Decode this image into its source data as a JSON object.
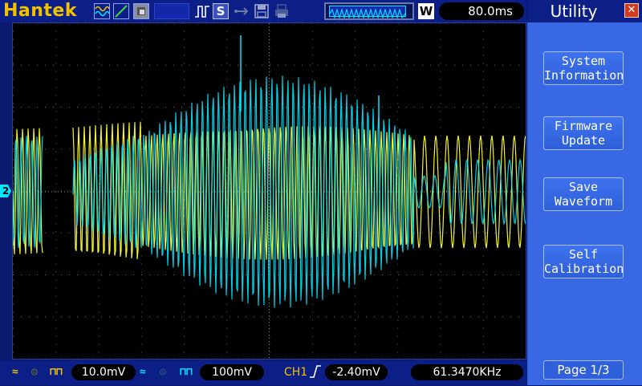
{
  "header": {
    "brand": "Hantek",
    "s_badge": "S",
    "w_badge": "W",
    "timebase": "80.0ms"
  },
  "footer": {
    "ch1_scale": "10.0mV",
    "ch2_scale": "100mV",
    "trigger_source": "CH1",
    "trigger_level": "-2.40mV",
    "frequency": "61.3470KHz"
  },
  "channel_marker": "2",
  "menu": {
    "title": "Utility",
    "close_glyph": "✕",
    "items": [
      {
        "line1": "System",
        "line2": "Information"
      },
      {
        "line1": "Firmware",
        "line2": "Update"
      },
      {
        "line1": "Save",
        "line2": "Waveform"
      },
      {
        "line1": "Self",
        "line2": "Calibration"
      }
    ],
    "page": "Page 1/3"
  },
  "colors": {
    "ch1": "#ffff33",
    "ch2": "#00e6ff",
    "accent": "#f2c200",
    "background": "#000000",
    "panel": "#3868e4"
  }
}
